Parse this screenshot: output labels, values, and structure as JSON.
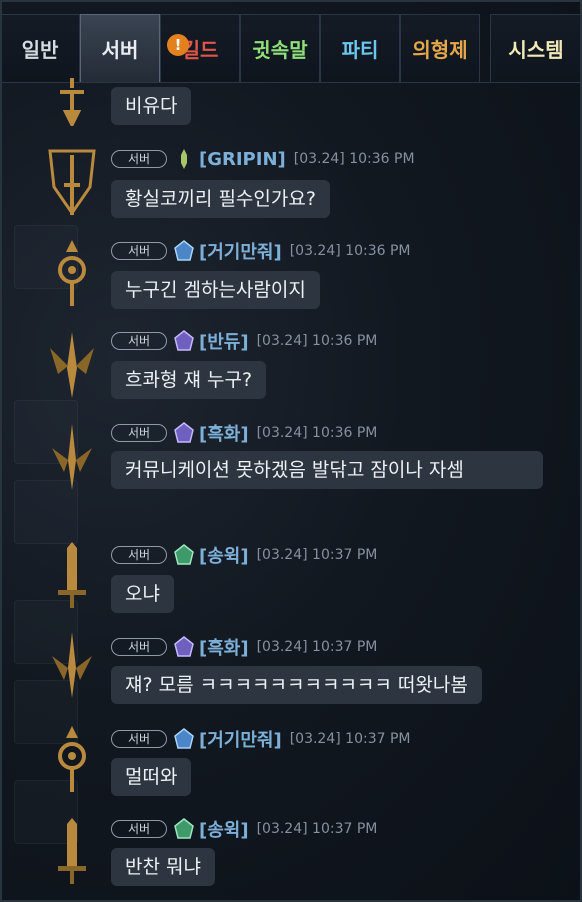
{
  "tabs": [
    {
      "label": "일반",
      "color": "#d6dbe0",
      "active": false
    },
    {
      "label": "서버",
      "color": "#eaeef2",
      "active": true
    },
    {
      "label": "길드",
      "color": "#e0554a",
      "active": false,
      "alert": "!"
    },
    {
      "label": "귓속말",
      "color": "#8fe07a",
      "active": false
    },
    {
      "label": "파티",
      "color": "#6cc7f0",
      "active": false
    },
    {
      "label": "의형제",
      "color": "#e6a84a",
      "active": false
    },
    {
      "label": "시스템",
      "color": "#f2e9b8",
      "active": false
    }
  ],
  "messages": [
    {
      "channel": "",
      "name": "",
      "time": "",
      "text": "비유다"
    },
    {
      "channel": "서버",
      "name": "[GRIPIN]",
      "time": "[03.24] 10:36 PM",
      "text": "황실코끼리 필수인가요?"
    },
    {
      "channel": "서버",
      "name": "[거기만줘]",
      "time": "[03.24] 10:36 PM",
      "text": "누구긴 겜하는사람이지"
    },
    {
      "channel": "서버",
      "name": "[반듀]",
      "time": "[03.24] 10:36 PM",
      "text": "흐콰형 쟤 누구?"
    },
    {
      "channel": "서버",
      "name": "[흑화]",
      "time": "[03.24] 10:36 PM",
      "text": "커뮤니케이션 못하겠음 발닦고 잠이나 자셈"
    },
    {
      "channel": "서버",
      "name": "[송윅]",
      "time": "[03.24] 10:37 PM",
      "text": "오냐"
    },
    {
      "channel": "서버",
      "name": "[흑화]",
      "time": "[03.24] 10:37 PM",
      "text": "쟤? 모름 ㅋㅋㅋㅋㅋㅋㅋㅋㅋㅋㅋ 떠왓나봄"
    },
    {
      "channel": "서버",
      "name": "[거기만줘]",
      "time": "[03.24] 10:37 PM",
      "text": "멀떠와"
    },
    {
      "channel": "서버",
      "name": "[송윅]",
      "time": "[03.24] 10:37 PM",
      "text": "반찬 뭐냐"
    }
  ],
  "icons": {
    "avatar_classes": [
      "sword-hilt-icon",
      "shield-sword-icon",
      "orb-staff-icon",
      "winged-blade-icon",
      "winged-blade-icon",
      "greatsword-icon",
      "winged-blade-icon",
      "orb-staff-icon",
      "greatsword-icon"
    ],
    "title_icons": [
      "",
      "dagger-title-icon",
      "blue-crest-icon",
      "purple-crest-icon",
      "purple-crest-icon",
      "green-crest-icon",
      "purple-crest-icon",
      "blue-crest-icon",
      "green-crest-icon"
    ]
  },
  "colors": {
    "bubble": "#2c3540",
    "username": "#7db0d8",
    "timestamp": "#8590a0",
    "gold": "#b98a3e"
  }
}
